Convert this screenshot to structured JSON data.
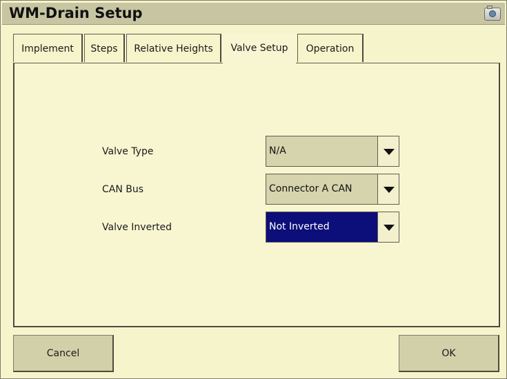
{
  "window": {
    "title": "WM-Drain Setup",
    "camera_icon": "camera-icon"
  },
  "tabs": [
    {
      "label": "Implement",
      "active": false
    },
    {
      "label": "Steps",
      "active": false
    },
    {
      "label": "Relative Heights",
      "active": false
    },
    {
      "label": "Valve Setup",
      "active": true
    },
    {
      "label": "Operation",
      "active": false
    }
  ],
  "fields": {
    "valve_type": {
      "label": "Valve Type",
      "value": "N/A"
    },
    "can_bus": {
      "label": "CAN Bus",
      "value": "Connector A CAN"
    },
    "valve_inverted": {
      "label": "Valve Inverted",
      "value": "Not Inverted"
    }
  },
  "buttons": {
    "cancel": "Cancel",
    "ok": "OK"
  },
  "colors": {
    "background": "#f6f4cb",
    "titlebar": "#c8c6a2",
    "selection": "#0c0e7a"
  }
}
